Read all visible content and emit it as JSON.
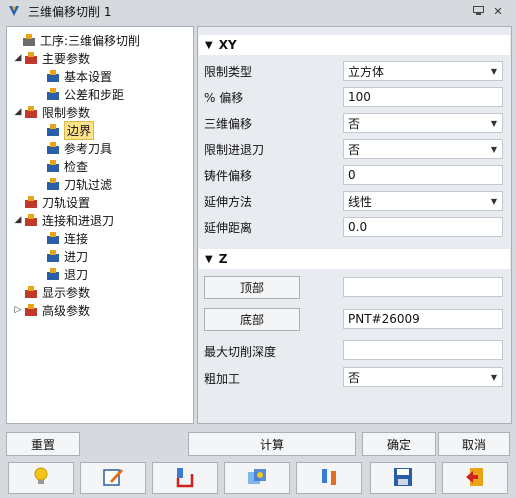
{
  "window": {
    "title": "三维偏移切削 1"
  },
  "tree": [
    {
      "label": "工序:三维偏移切削",
      "icon": "operation-icon",
      "level": 0,
      "expander": ""
    },
    {
      "label": "主要参数",
      "icon": "main-params-icon",
      "level": 1,
      "expander": "◢"
    },
    {
      "label": "基本设置",
      "icon": "basic-settings-icon",
      "level": 2,
      "expander": ""
    },
    {
      "label": "公差和步距",
      "icon": "tolerance-icon",
      "level": 2,
      "expander": ""
    },
    {
      "label": "限制参数",
      "icon": "limit-params-icon",
      "level": 1,
      "expander": "◢"
    },
    {
      "label": "边界",
      "icon": "boundary-icon",
      "level": 2,
      "expander": "",
      "selected": true
    },
    {
      "label": "参考刀具",
      "icon": "ref-tool-icon",
      "level": 2,
      "expander": ""
    },
    {
      "label": "检查",
      "icon": "check-icon",
      "level": 2,
      "expander": ""
    },
    {
      "label": "刀轨过滤",
      "icon": "filter-icon",
      "level": 2,
      "expander": ""
    },
    {
      "label": "刀轨设置",
      "icon": "toolpath-settings-icon",
      "level": 1,
      "expander": ""
    },
    {
      "label": "连接和进退刀",
      "icon": "link-icon",
      "level": 1,
      "expander": "◢"
    },
    {
      "label": "连接",
      "icon": "connect-icon",
      "level": 2,
      "expander": ""
    },
    {
      "label": "进刀",
      "icon": "lead-in-icon",
      "level": 2,
      "expander": ""
    },
    {
      "label": "退刀",
      "icon": "lead-out-icon",
      "level": 2,
      "expander": ""
    },
    {
      "label": "显示参数",
      "icon": "display-params-icon",
      "level": 1,
      "expander": ""
    },
    {
      "label": "高级参数",
      "icon": "advanced-params-icon",
      "level": 1,
      "expander": "▷"
    }
  ],
  "xy": {
    "title": "XY",
    "rows": [
      {
        "label": "限制类型",
        "value": "立方体",
        "dropdown": true
      },
      {
        "label": "% 偏移",
        "value": "100",
        "dropdown": false
      },
      {
        "label": "三维偏移",
        "value": "否",
        "dropdown": true
      },
      {
        "label": "限制进退刀",
        "value": "否",
        "dropdown": true
      },
      {
        "label": "铸件偏移",
        "value": "0",
        "dropdown": false
      },
      {
        "label": "延伸方法",
        "value": "线性",
        "dropdown": true
      },
      {
        "label": "延伸距离",
        "value": "0.0",
        "dropdown": false
      }
    ]
  },
  "z": {
    "title": "Z",
    "top_button": "顶部",
    "top_value": "",
    "bottom_button": "底部",
    "bottom_value": "PNT#26009",
    "max_depth_label": "最大切削深度",
    "max_depth_value": "",
    "rough_label": "粗加工",
    "rough_value": "否"
  },
  "actions": {
    "reset": "重置",
    "calculate": "计算",
    "ok": "确定",
    "cancel": "取消"
  },
  "toolbar": [
    "bulb-icon",
    "edit-icon",
    "tool-icon",
    "render-icon",
    "swap-icon",
    "save-icon",
    "exit-icon"
  ],
  "colors": {
    "selected_bg": "#fde48a",
    "panel_bg": "#e8ebef",
    "window_bg": "#d6d9de"
  }
}
